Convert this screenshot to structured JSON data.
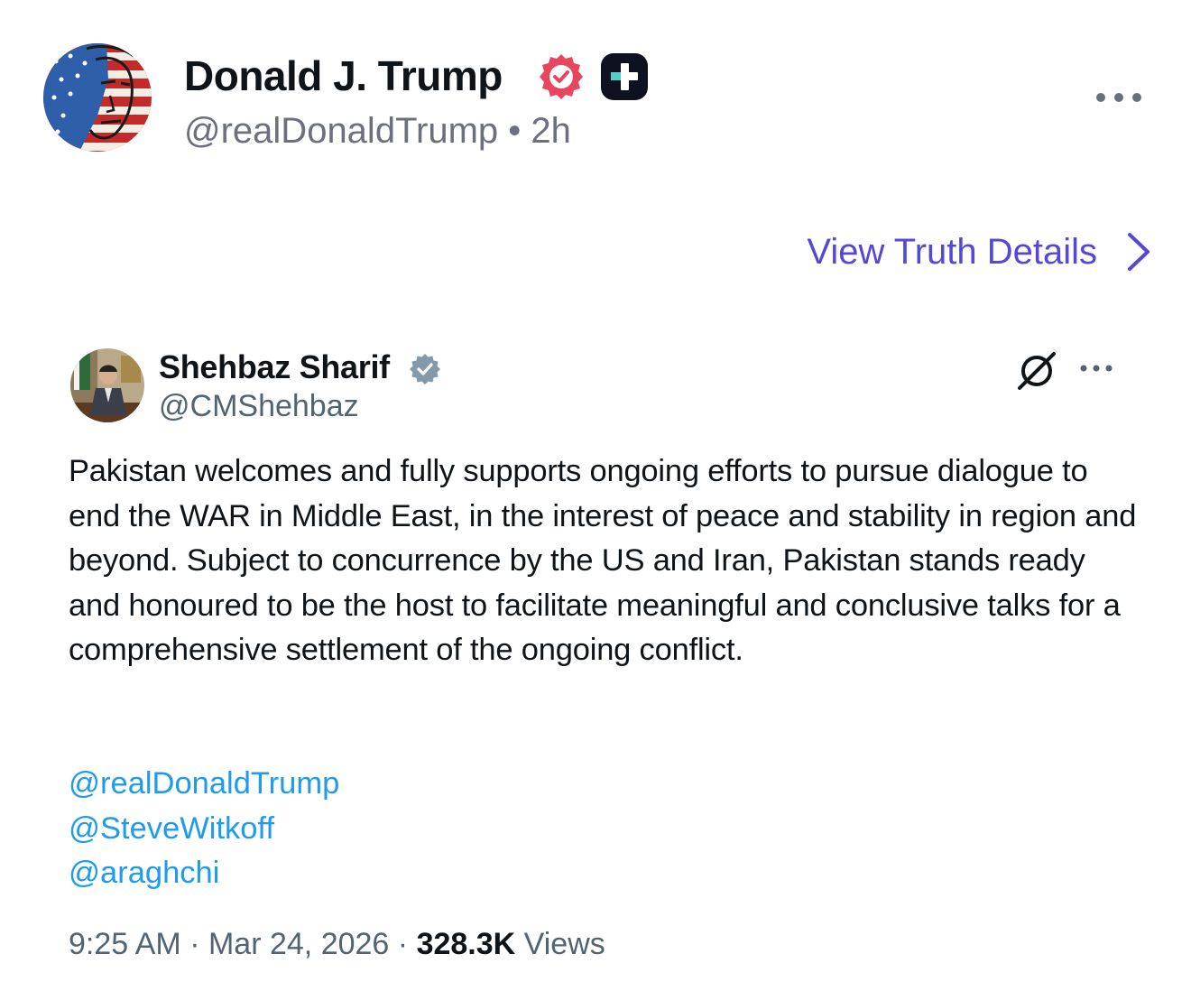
{
  "post": {
    "author": {
      "name": "Donald J. Trump",
      "handle": "@realDonaldTrump",
      "separator": "•",
      "time": "2h",
      "verified_icon": "verified-badge-icon",
      "plus_icon": "plus-badge-icon",
      "avatar_icon": "avatar"
    },
    "more_icon": "more-options-icon",
    "view_details_label": "View Truth Details",
    "view_details_icon": "chevron-right-icon",
    "colors": {
      "link": "#5548d9",
      "verified": "#e8455f",
      "muted": "#6b6f80"
    }
  },
  "embed": {
    "author": {
      "name": "Shehbaz Sharif",
      "handle": "@CMShehbaz",
      "verified_icon": "verified-badge-icon",
      "avatar_icon": "avatar"
    },
    "grok_icon": "grok-icon",
    "more_icon": "more-options-icon",
    "text": "Pakistan welcomes and fully supports ongoing efforts to pursue dialogue to end the WAR in Middle East, in the interest of peace and stability in region and beyond. Subject to concurrence by the US and Iran, Pakistan stands ready and honoured to be the host to facilitate meaningful and conclusive talks for a comprehensive settlement of the ongoing conflict.",
    "mentions": [
      "@realDonaldTrump",
      "@SteveWitkoff",
      "@araghchi"
    ],
    "time": "9:25 AM",
    "date": "Mar 24, 2026",
    "dot": "·",
    "views_count": "328.3K",
    "views_label": "Views",
    "colors": {
      "mention": "#1d9bf0",
      "muted": "#536471",
      "verified": "#829aab"
    }
  }
}
